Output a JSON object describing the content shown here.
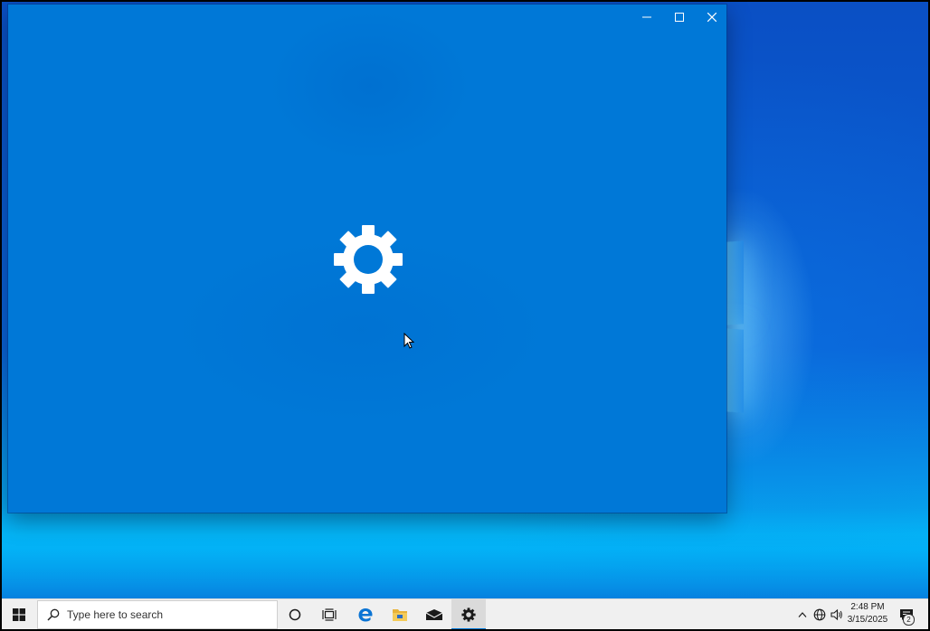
{
  "desktop": {
    "accent_color": "#0078d7"
  },
  "settings_window": {
    "controls": {
      "minimize_icon": "minimize-icon",
      "maximize_icon": "maximize-icon",
      "close_icon": "close-icon"
    },
    "splash_icon": "gear-icon"
  },
  "taskbar": {
    "start_icon": "windows-logo-icon",
    "search_placeholder": "Type here to search",
    "apps": [
      {
        "icon": "cortana-icon"
      },
      {
        "icon": "task-view-icon"
      },
      {
        "icon": "edge-icon"
      },
      {
        "icon": "file-explorer-icon"
      },
      {
        "icon": "mail-icon"
      },
      {
        "icon": "settings-icon",
        "active": true
      }
    ],
    "tray": {
      "icons": [
        "chevron-up-icon",
        "network-icon",
        "volume-icon"
      ],
      "time": "2:48 PM",
      "date": "3/15/2025",
      "notification_count": "2"
    }
  }
}
